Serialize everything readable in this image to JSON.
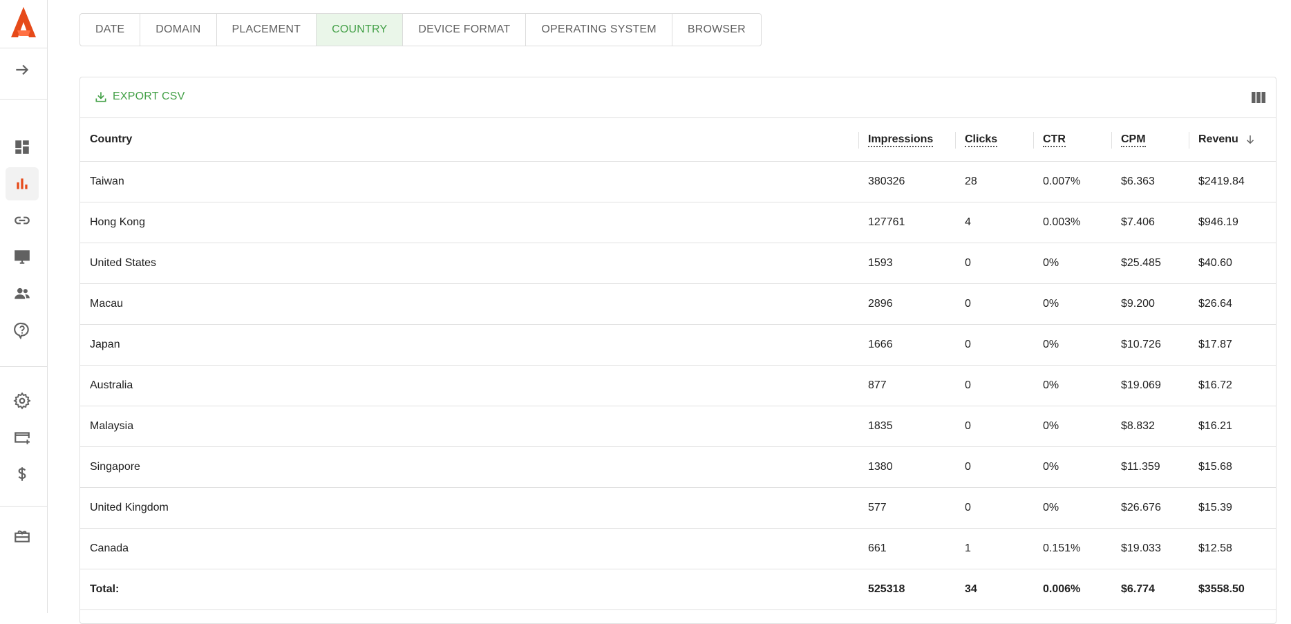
{
  "brand": {
    "logo_icon": "app-logo-icon",
    "accent": "#e64a19",
    "green": "#43a047"
  },
  "sidebar": {
    "items": [
      {
        "name": "expand",
        "icon": "arrow-right-icon",
        "active": false
      },
      {
        "name": "dashboard",
        "icon": "dashboard-icon",
        "active": false
      },
      {
        "name": "reports",
        "icon": "bar-chart-icon",
        "active": true
      },
      {
        "name": "links",
        "icon": "link-icon",
        "active": false
      },
      {
        "name": "devices",
        "icon": "monitor-icon",
        "active": false
      },
      {
        "name": "users",
        "icon": "people-icon",
        "active": false
      },
      {
        "name": "help",
        "icon": "help-icon",
        "active": false
      },
      {
        "name": "settings",
        "icon": "gear-icon",
        "active": false
      },
      {
        "name": "payment-method",
        "icon": "card-plus-icon",
        "active": false
      },
      {
        "name": "payments",
        "icon": "dollar-icon",
        "active": false
      },
      {
        "name": "rewards",
        "icon": "gift-icon",
        "active": false
      }
    ]
  },
  "tabs": [
    {
      "label": "DATE",
      "active": false
    },
    {
      "label": "DOMAIN",
      "active": false
    },
    {
      "label": "PLACEMENT",
      "active": false
    },
    {
      "label": "COUNTRY",
      "active": true
    },
    {
      "label": "DEVICE FORMAT",
      "active": false
    },
    {
      "label": "OPERATING SYSTEM",
      "active": false
    },
    {
      "label": "BROWSER",
      "active": false
    }
  ],
  "toolbar": {
    "export_label": "EXPORT CSV",
    "export_icon": "download-icon",
    "columns_icon": "columns-icon"
  },
  "table": {
    "headers": {
      "country": "Country",
      "impressions": "Impressions",
      "clicks": "Clicks",
      "ctr": "CTR",
      "cpm": "CPM",
      "revenue": "Revenu"
    },
    "sort_icon": "arrow-down-icon",
    "rows": [
      [
        "Taiwan",
        "380326",
        "28",
        "0.007%",
        "$6.363",
        "$2419.84"
      ],
      [
        "Hong Kong",
        "127761",
        "4",
        "0.003%",
        "$7.406",
        "$946.19"
      ],
      [
        "United States",
        "1593",
        "0",
        "0%",
        "$25.485",
        "$40.60"
      ],
      [
        "Macau",
        "2896",
        "0",
        "0%",
        "$9.200",
        "$26.64"
      ],
      [
        "Japan",
        "1666",
        "0",
        "0%",
        "$10.726",
        "$17.87"
      ],
      [
        "Australia",
        "877",
        "0",
        "0%",
        "$19.069",
        "$16.72"
      ],
      [
        "Malaysia",
        "1835",
        "0",
        "0%",
        "$8.832",
        "$16.21"
      ],
      [
        "Singapore",
        "1380",
        "0",
        "0%",
        "$11.359",
        "$15.68"
      ],
      [
        "United Kingdom",
        "577",
        "0",
        "0%",
        "$26.676",
        "$15.39"
      ],
      [
        "Canada",
        "661",
        "1",
        "0.151%",
        "$19.033",
        "$12.58"
      ]
    ],
    "total": [
      "Total:",
      "525318",
      "34",
      "0.006%",
      "$6.774",
      "$3558.50"
    ]
  }
}
